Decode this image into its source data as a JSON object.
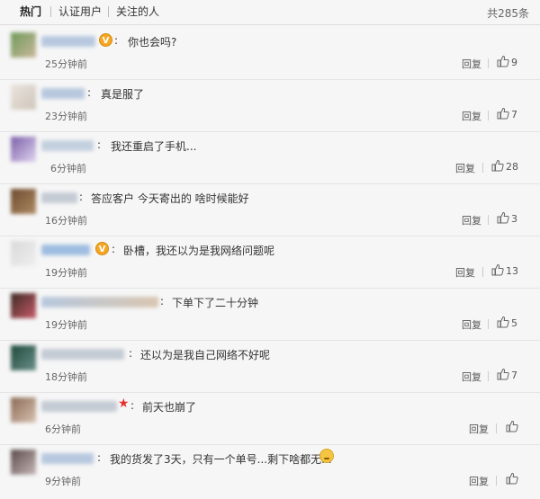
{
  "tabs": [
    "热门",
    "认证用户",
    "关注的人"
  ],
  "total": "共285条",
  "reply_label": "回复",
  "comments": [
    {
      "text": "你也会吗?",
      "time": "25分钟前",
      "likes": "9",
      "badge": "verified"
    },
    {
      "text": "真是服了",
      "time": "23分钟前",
      "likes": "7"
    },
    {
      "text": "我还重启了手机...",
      "time": "6分钟前",
      "likes": "28"
    },
    {
      "text": "答应客户 今天寄出的 啥时候能好",
      "time": "16分钟前",
      "likes": "3"
    },
    {
      "text": "卧槽，我还以为是我网络问题呢",
      "time": "19分钟前",
      "likes": "13",
      "badge": "verified"
    },
    {
      "text": "下单下了二十分钟",
      "time": "19分钟前",
      "likes": "5"
    },
    {
      "text": "还以为是我自己网络不好呢",
      "time": "18分钟前",
      "likes": "7"
    },
    {
      "text": "前天也崩了",
      "time": "6分钟前",
      "likes": "",
      "badge": "star"
    },
    {
      "text": "我的货发了3天，只有一个单号...剩下啥都无...",
      "time": "9分钟前",
      "likes": "",
      "emoji": "smiley-emoji"
    }
  ],
  "colors": {
    "verified": "#f5a623",
    "star": "#e5322d",
    "separator": "#e4e4e4"
  }
}
